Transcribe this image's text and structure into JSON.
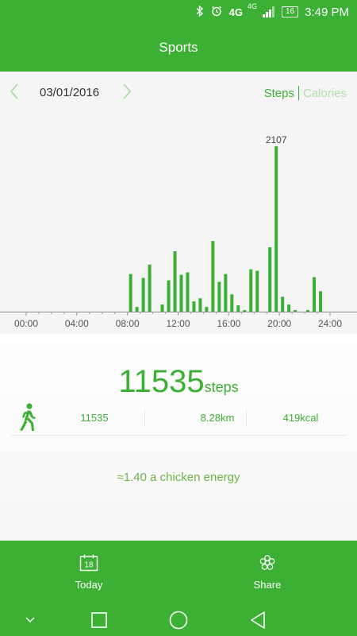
{
  "status_bar": {
    "bluetooth_icon": "bluetooth-icon",
    "alarm_icon": "alarm-icon",
    "network_primary": "4G",
    "network_secondary": "4G",
    "battery": "16",
    "time": "3:49 PM"
  },
  "header": {
    "title": "Sports"
  },
  "date_nav": {
    "prev_icon": "chevron-left-icon",
    "date": "03/01/2016",
    "next_icon": "chevron-right-icon",
    "toggle_steps": "Steps",
    "toggle_calories": "Calories"
  },
  "chart_data": {
    "type": "bar",
    "title": "",
    "xlabel": "",
    "ylabel": "",
    "x_range": [
      0,
      24
    ],
    "xticks": [
      "00:00",
      "04:00",
      "08:00",
      "12:00",
      "16:00",
      "20:00",
      "24:00"
    ],
    "ylim": [
      0,
      2107
    ],
    "peak_label": "2107",
    "color": "#3cb034",
    "bars": [
      {
        "t": 8.25,
        "value": 480
      },
      {
        "t": 8.75,
        "value": 60
      },
      {
        "t": 9.25,
        "value": 430
      },
      {
        "t": 9.75,
        "value": 600
      },
      {
        "t": 10.75,
        "value": 90
      },
      {
        "t": 11.25,
        "value": 400
      },
      {
        "t": 11.75,
        "value": 770
      },
      {
        "t": 12.25,
        "value": 470
      },
      {
        "t": 12.75,
        "value": 500
      },
      {
        "t": 13.25,
        "value": 130
      },
      {
        "t": 13.75,
        "value": 170
      },
      {
        "t": 14.25,
        "value": 60
      },
      {
        "t": 14.75,
        "value": 900
      },
      {
        "t": 15.25,
        "value": 380
      },
      {
        "t": 15.75,
        "value": 480
      },
      {
        "t": 16.25,
        "value": 220
      },
      {
        "t": 16.75,
        "value": 80
      },
      {
        "t": 17.25,
        "value": 20
      },
      {
        "t": 17.75,
        "value": 540
      },
      {
        "t": 18.25,
        "value": 520
      },
      {
        "t": 19.25,
        "value": 820
      },
      {
        "t": 19.75,
        "value": 2107
      },
      {
        "t": 20.25,
        "value": 190
      },
      {
        "t": 20.75,
        "value": 90
      },
      {
        "t": 21.25,
        "value": 20
      },
      {
        "t": 22.25,
        "value": 20
      },
      {
        "t": 22.75,
        "value": 440
      },
      {
        "t": 23.25,
        "value": 260
      }
    ]
  },
  "summary": {
    "total_steps": "11535",
    "steps_unit": "steps",
    "walk_icon": "walking-person-icon",
    "steps": "11535",
    "distance": "8.28km",
    "calories": "419kcal",
    "energy_text": "≈1.40 a chicken energy"
  },
  "bottom_bar": {
    "today_icon": "calendar-icon",
    "today_badge": "18",
    "today_label": "Today",
    "share_icon": "flower-share-icon",
    "share_label": "Share"
  },
  "nav_bar": {
    "icons": [
      "chevron-down-icon",
      "square-recents-icon",
      "circle-home-icon",
      "triangle-back-icon"
    ]
  }
}
